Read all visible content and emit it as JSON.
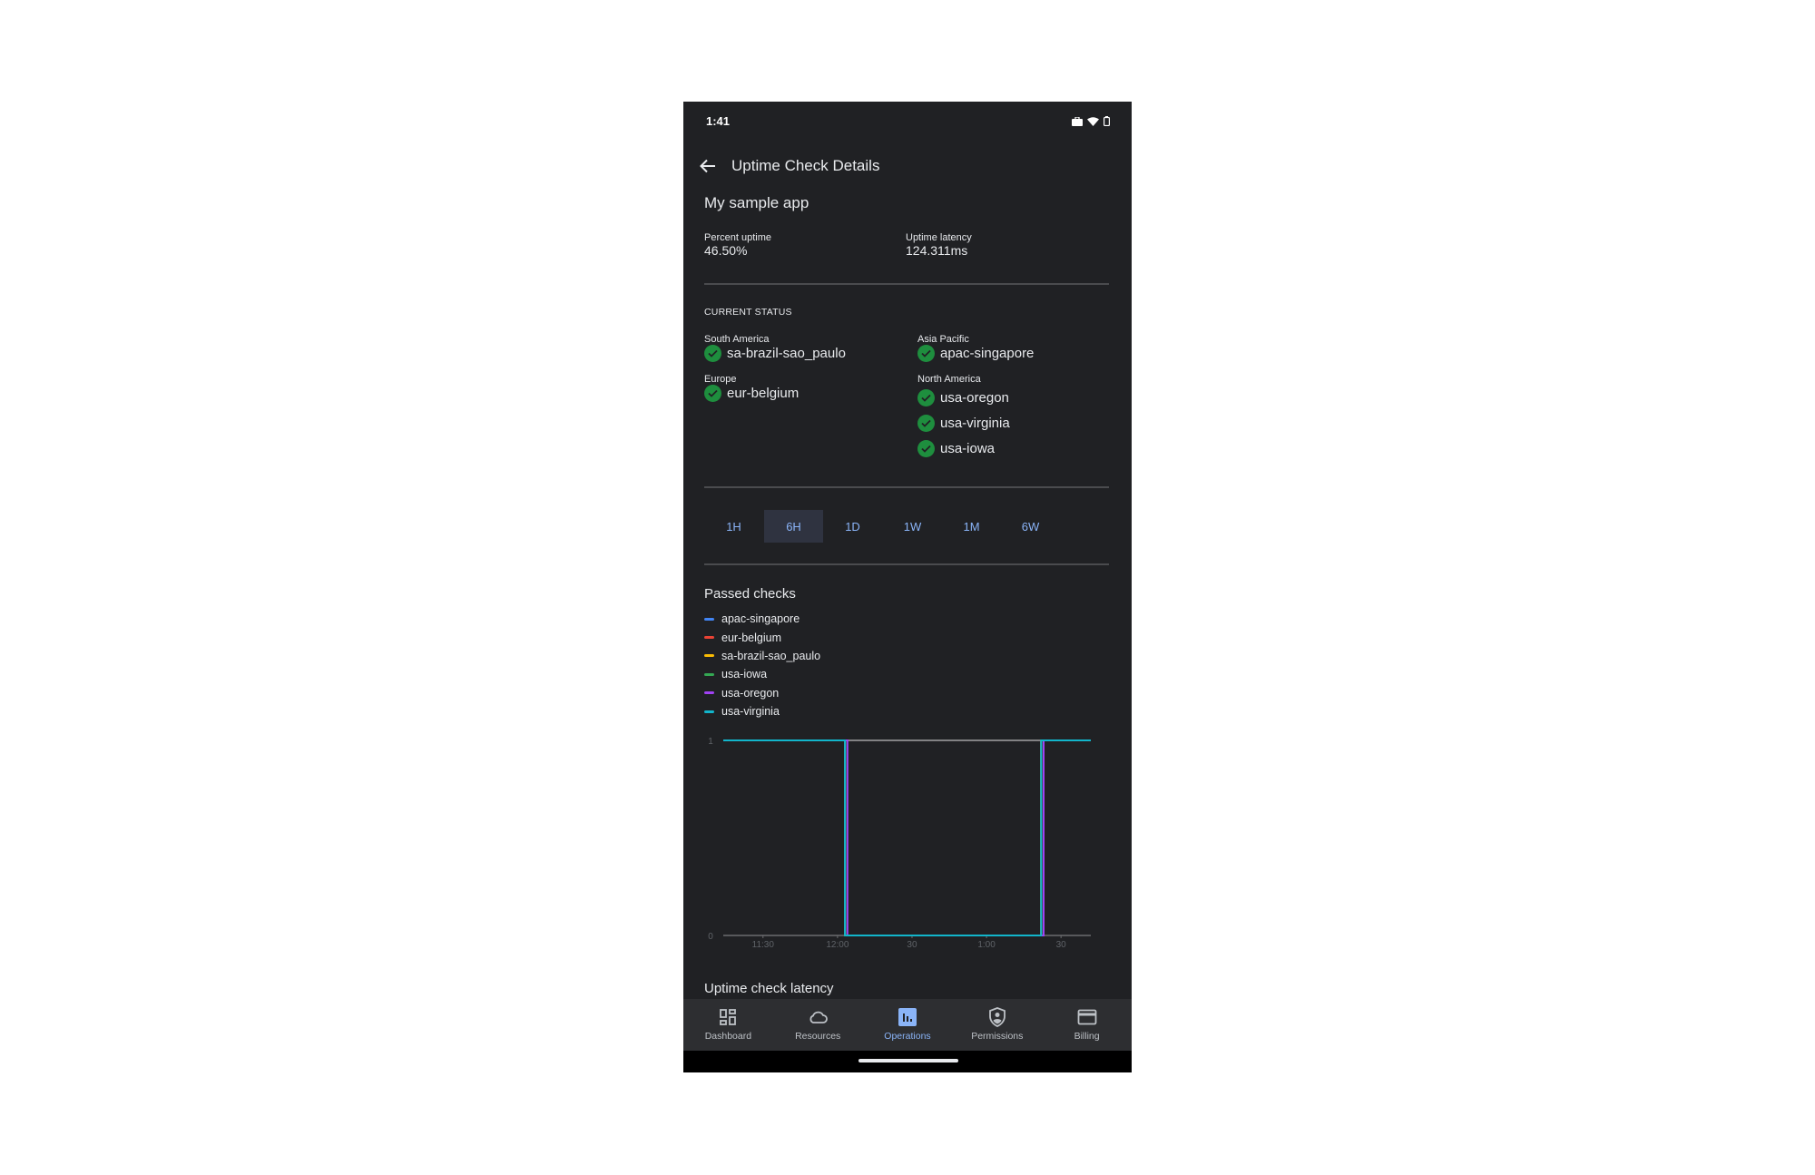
{
  "status_bar": {
    "time": "1:41",
    "icons": [
      "work-profile-icon",
      "wifi-icon",
      "battery-icon"
    ]
  },
  "toolbar": {
    "back_icon": "arrow-back-icon",
    "title": "Uptime Check Details"
  },
  "app_name": "My sample app",
  "metrics": {
    "percent_uptime_label": "Percent uptime",
    "percent_uptime_value": "46.50%",
    "latency_label": "Uptime latency",
    "latency_value": "124.311ms"
  },
  "current_status": {
    "heading": "CURRENT STATUS",
    "regions": [
      {
        "name": "South America",
        "checks": [
          "sa-brazil-sao_paulo"
        ]
      },
      {
        "name": "Europe",
        "checks": [
          "eur-belgium"
        ]
      },
      {
        "name": "Asia Pacific",
        "checks": [
          "apac-singapore"
        ]
      },
      {
        "name": "North America",
        "checks": [
          "usa-oregon",
          "usa-virginia",
          "usa-iowa"
        ]
      }
    ],
    "status_icon": "check-circle-icon",
    "status_color": "#1e8e3e"
  },
  "time_ranges": {
    "options": [
      "1H",
      "6H",
      "1D",
      "1W",
      "1M",
      "6W"
    ],
    "selected": "6H",
    "accent_color": "#8ab4f8"
  },
  "chart_data": {
    "type": "line",
    "title": "Passed checks",
    "xlabel": "",
    "ylabel": "",
    "x_tick_labels": [
      "11:30",
      "12:00",
      "30",
      "1:00",
      "30"
    ],
    "y_tick_labels": [
      "0",
      "1"
    ],
    "ylim": [
      0,
      1
    ],
    "x_unit": "minutes since 11:00",
    "xlim": [
      14,
      112
    ],
    "x_ticks": [
      30,
      60,
      90,
      120,
      150
    ],
    "legend_position": "top-left",
    "series": [
      {
        "name": "apac-singapore",
        "color": "#4285f4",
        "points": [
          [
            14,
            1
          ],
          [
            63,
            1
          ],
          [
            63,
            0
          ],
          [
            142,
            0
          ],
          [
            142,
            1
          ],
          [
            162,
            1
          ]
        ]
      },
      {
        "name": "eur-belgium",
        "color": "#ea4335",
        "points": [
          [
            14,
            1
          ],
          [
            63,
            1
          ],
          [
            63,
            0
          ],
          [
            142,
            0
          ],
          [
            142,
            1
          ],
          [
            162,
            1
          ]
        ]
      },
      {
        "name": "sa-brazil-sao_paulo",
        "color": "#fbbc04",
        "points": [
          [
            14,
            1
          ],
          [
            63,
            1
          ],
          [
            63,
            0
          ],
          [
            142,
            0
          ],
          [
            142,
            1
          ],
          [
            162,
            1
          ]
        ]
      },
      {
        "name": "usa-iowa",
        "color": "#34a853",
        "points": [
          [
            14,
            1
          ],
          [
            63,
            1
          ],
          [
            63,
            0
          ],
          [
            142,
            0
          ],
          [
            142,
            1
          ],
          [
            162,
            1
          ]
        ]
      },
      {
        "name": "usa-oregon",
        "color": "#a142f4",
        "points": [
          [
            14,
            1
          ],
          [
            64,
            1
          ],
          [
            64,
            0
          ],
          [
            143,
            0
          ],
          [
            143,
            1
          ],
          [
            162,
            1
          ]
        ]
      },
      {
        "name": "usa-virginia",
        "color": "#12b5cb",
        "points": [
          [
            14,
            1
          ],
          [
            63,
            1
          ],
          [
            63,
            0
          ],
          [
            142,
            0
          ],
          [
            142,
            1
          ],
          [
            162,
            1
          ]
        ]
      }
    ],
    "reference_line": {
      "value": 1,
      "color": "#bdbdbd"
    }
  },
  "latency_section": {
    "title": "Uptime check latency"
  },
  "bottom_nav": {
    "items": [
      {
        "label": "Dashboard",
        "icon": "dashboard-icon",
        "active": false
      },
      {
        "label": "Resources",
        "icon": "cloud-icon",
        "active": false
      },
      {
        "label": "Operations",
        "icon": "bar-chart-icon",
        "active": true
      },
      {
        "label": "Permissions",
        "icon": "shield-person-icon",
        "active": false
      },
      {
        "label": "Billing",
        "icon": "credit-card-icon",
        "active": false
      }
    ]
  }
}
